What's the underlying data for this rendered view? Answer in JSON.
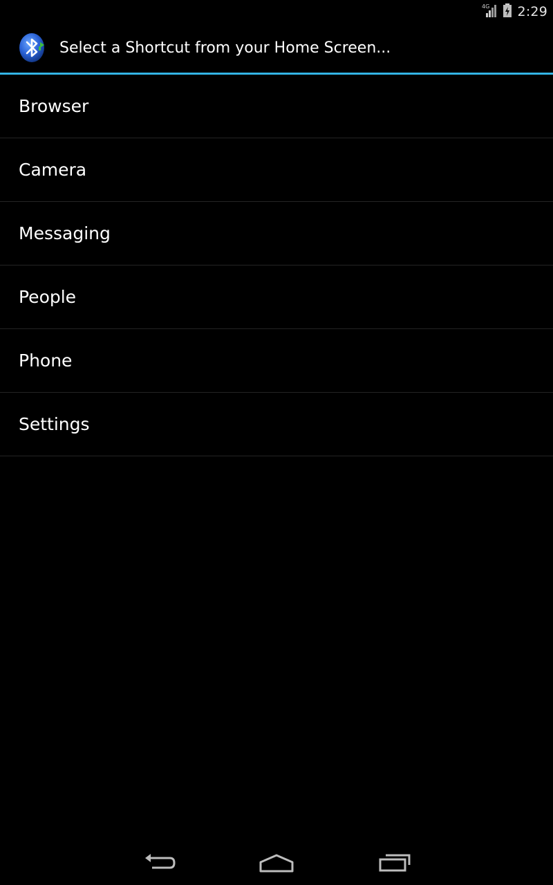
{
  "status_bar": {
    "network_label": "4G",
    "time": "2:29"
  },
  "header": {
    "app_icon": "bluetooth-icon",
    "title": "Select a Shortcut from your Home Screen..."
  },
  "shortcuts": [
    {
      "label": "Browser"
    },
    {
      "label": "Camera"
    },
    {
      "label": "Messaging"
    },
    {
      "label": "People"
    },
    {
      "label": "Phone"
    },
    {
      "label": "Settings"
    }
  ],
  "navigation": {
    "back_icon": "back-icon",
    "home_icon": "home-icon",
    "recents_icon": "recent-apps-icon"
  },
  "colors": {
    "background": "#000000",
    "accent": "#33b5e5",
    "divider": "#242424",
    "text": "#ffffff"
  }
}
